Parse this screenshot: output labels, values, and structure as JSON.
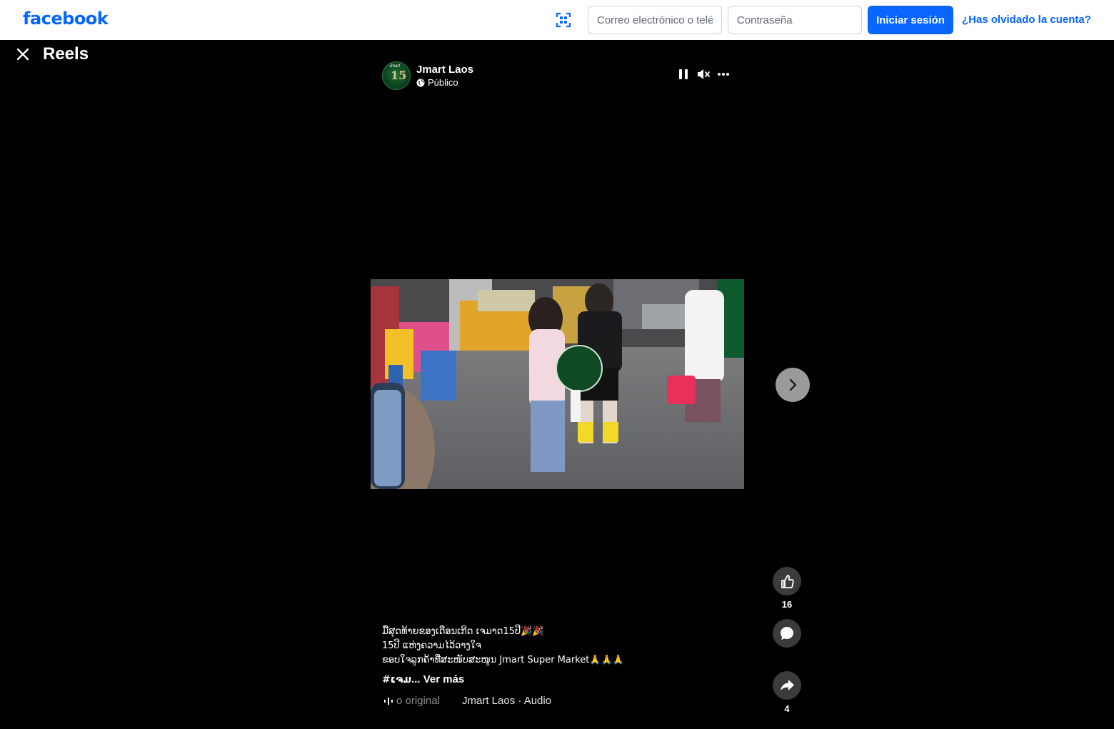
{
  "header": {
    "logo": "facebook",
    "email_placeholder": "Correo electrónico o teléfono",
    "password_placeholder": "Contraseña",
    "login_label": "Iniciar sesión",
    "forgot_label": "¿Has olvidado la cuenta?"
  },
  "page": {
    "title": "Reels"
  },
  "post": {
    "author": "Jmart Laos",
    "privacy": "Público",
    "avatar_badge": "15",
    "avatar_brand": "Jmart",
    "caption_lines": [
      "ມື້ສຸດທ້າຍຂອງເດືອນເກີດ ເຈມາດ15ປີ🎉🎉",
      "15ປີ ແຫ່ງຄວາມໄວ້ວາງໃຈ",
      "ຂອບໃຈລູກຄ້າທີ່ສະໜັບສະໜູນ Jmart Super Market🙏🙏🙏"
    ],
    "hashtag": "#ເຈມ",
    "see_more": "... Ver más",
    "audio_label": "o original",
    "audio_author": "Jmart Laos · Audio",
    "likes": "16",
    "shares": "4"
  },
  "colors": {
    "brand": "#0866ff",
    "action_bg": "#3a3b3c"
  }
}
